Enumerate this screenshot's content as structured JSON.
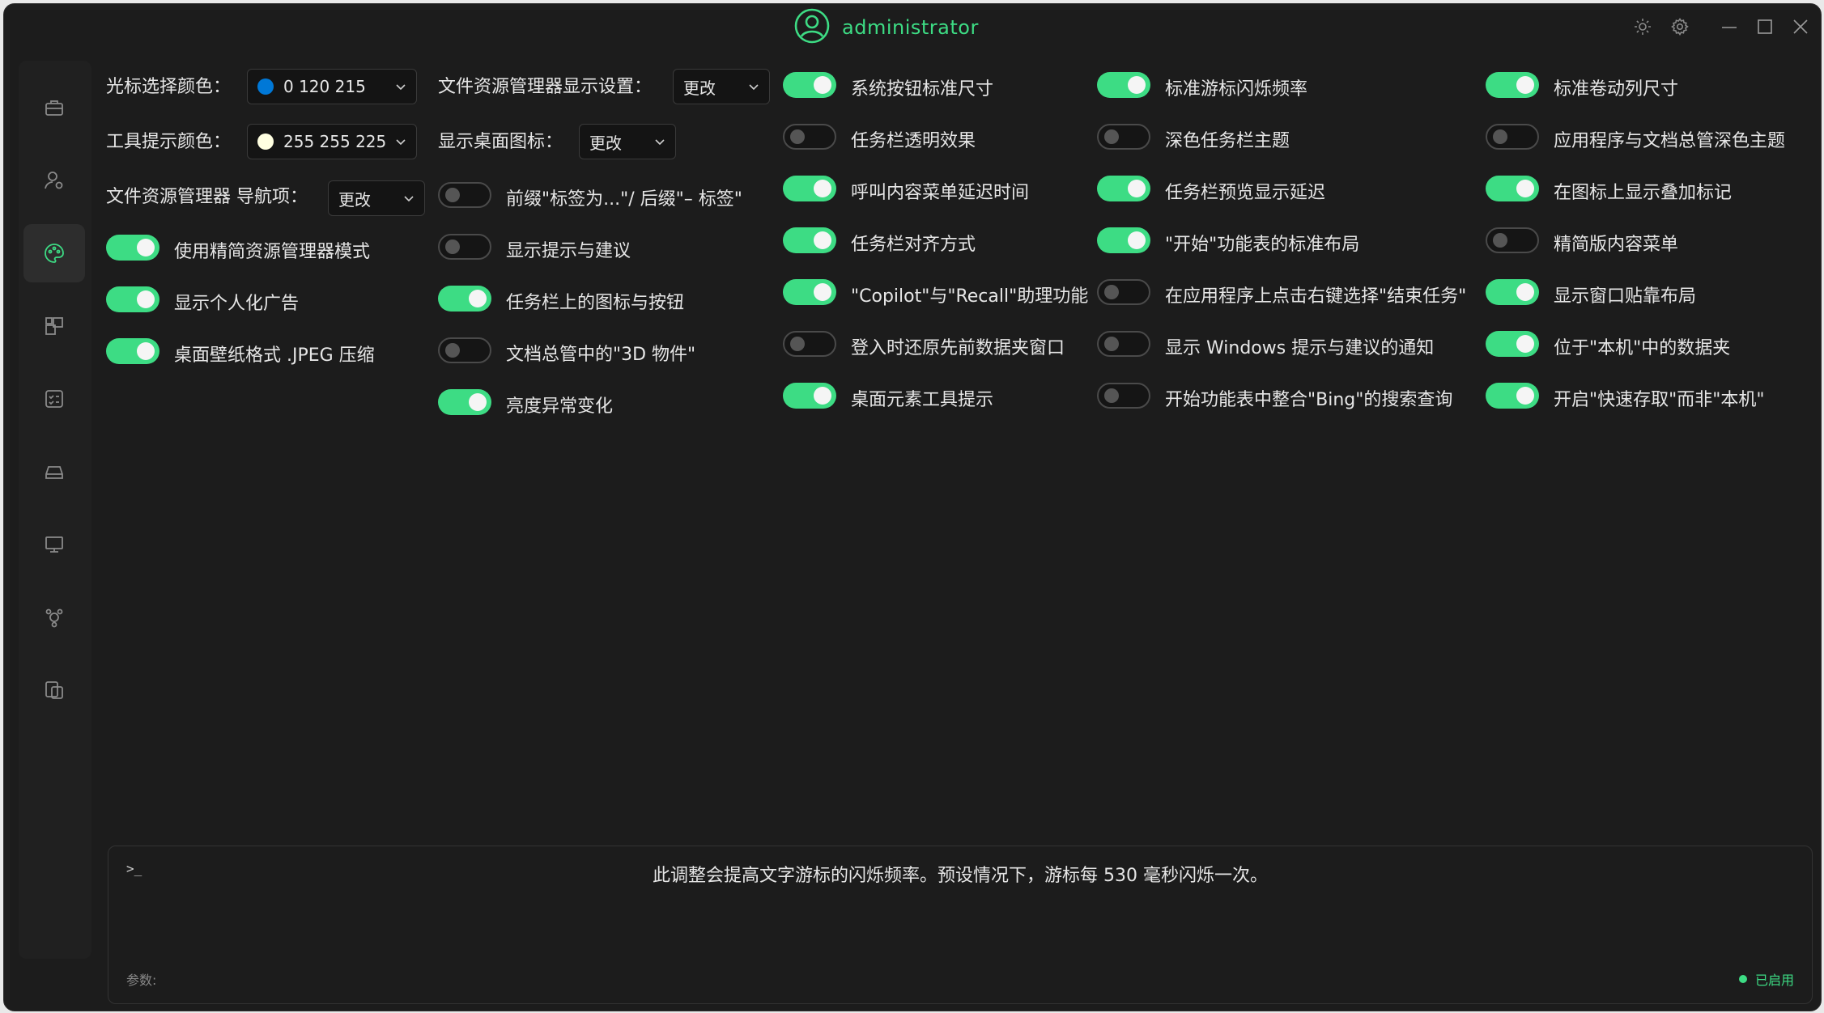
{
  "title_bar": {
    "username": "administrator"
  },
  "form": {
    "cursor_color_label": "光标选择颜色：",
    "cursor_color_value": "0 120 215",
    "cursor_color_hex": "#0078d7",
    "tooltip_color_label": "工具提示颜色：",
    "tooltip_color_value": "255 255 225",
    "tooltip_color_hex": "#ffffe1",
    "explorer_nav_label": "文件资源管理器 导航项：",
    "explorer_nav_value": "更改",
    "explorer_display_label": "文件资源管理器显示设置：",
    "explorer_display_value": "更改",
    "desktop_icons_label": "显示桌面图标：",
    "desktop_icons_value": "更改"
  },
  "toggles": [
    {
      "label": "使用精简资源管理器模式",
      "on": true
    },
    {
      "label": "显示个人化广告",
      "on": true
    },
    {
      "label": "桌面壁纸格式 .JPEG 压缩",
      "on": true
    },
    {
      "label": "前缀\"标签为...\"/ 后缀\"– 标签\"",
      "on": false
    },
    {
      "label": "显示提示与建议",
      "on": false
    },
    {
      "label": "任务栏上的图标与按钮",
      "on": true
    },
    {
      "label": "文档总管中的\"3D 物件\"",
      "on": false
    },
    {
      "label": "亮度异常变化",
      "on": true
    },
    {
      "label": "系统按钮标准尺寸",
      "on": true
    },
    {
      "label": "任务栏透明效果",
      "on": false
    },
    {
      "label": "呼叫内容菜单延迟时间",
      "on": true
    },
    {
      "label": "任务栏对齐方式",
      "on": true
    },
    {
      "label": "\"Copilot\"与\"Recall\"助理功能",
      "on": true
    },
    {
      "label": "登入时还原先前数据夹窗口",
      "on": false
    },
    {
      "label": "桌面元素工具提示",
      "on": true
    },
    {
      "label": "标准游标闪烁频率",
      "on": true
    },
    {
      "label": "深色任务栏主题",
      "on": false
    },
    {
      "label": "任务栏预览显示延迟",
      "on": true
    },
    {
      "label": "\"开始\"功能表的标准布局",
      "on": true
    },
    {
      "label": "在应用程序上点击右键选择\"结束任务\"",
      "on": false
    },
    {
      "label": "显示 Windows 提示与建议的通知",
      "on": false
    },
    {
      "label": "开始功能表中整合\"Bing\"的搜索查询",
      "on": false
    },
    {
      "label": "标准卷动列尺寸",
      "on": true
    },
    {
      "label": "应用程序与文档总管深色主题",
      "on": false
    },
    {
      "label": "在图标上显示叠加标记",
      "on": true
    },
    {
      "label": "精简版内容菜单",
      "on": false
    },
    {
      "label": "显示窗口贴靠布局",
      "on": true
    },
    {
      "label": "位于\"本机\"中的数据夹",
      "on": true
    },
    {
      "label": "开启\"快速存取\"而非\"本机\"",
      "on": true
    }
  ],
  "console": {
    "prompt": ">_",
    "description": "此调整会提高文字游标的闪烁频率。预设情况下，游标每 530 毫秒闪烁一次。",
    "params_label": "参数:",
    "status": "已启用"
  },
  "colors": {
    "accent": "#3ddc84",
    "background": "#1c1c1c"
  }
}
